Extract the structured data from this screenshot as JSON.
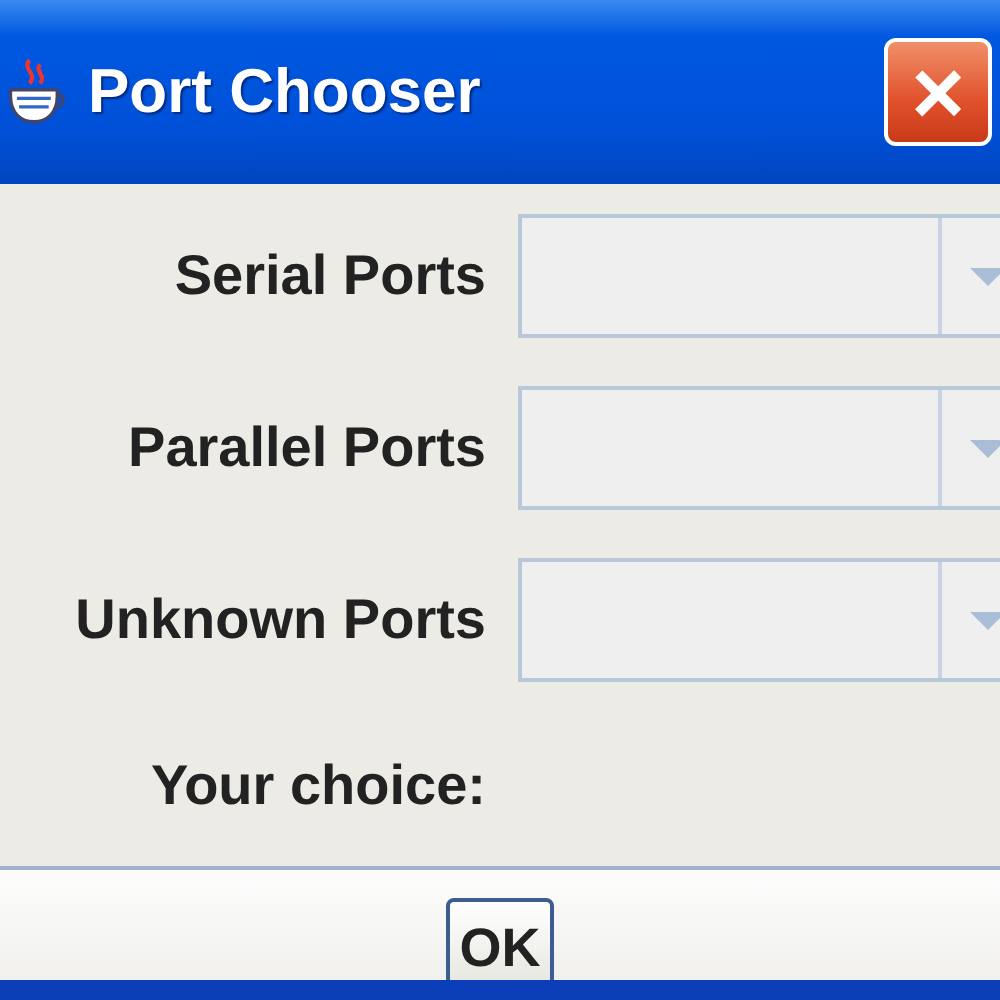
{
  "window": {
    "title": "Port Chooser",
    "close": "×"
  },
  "rows": [
    {
      "label": "Serial Ports",
      "disabled": true
    },
    {
      "label": "Parallel Ports",
      "disabled": true
    },
    {
      "label": "Unknown Ports",
      "disabled": true
    }
  ],
  "choice_label": "Your choice:",
  "buttons": [
    "OK"
  ]
}
